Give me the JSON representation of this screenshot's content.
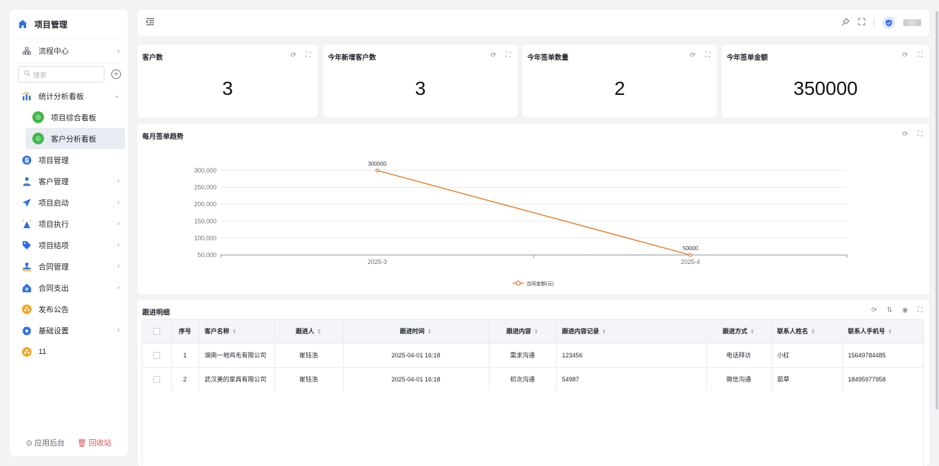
{
  "sidebar": {
    "app_title": "项目管理",
    "flow_center": "流程中心",
    "search_placeholder": "搜索",
    "items": [
      {
        "label": "统计分析看板",
        "icon": "bar-chart-icon",
        "color": "#2f6fdf",
        "expanded": true
      },
      {
        "label": "项目管理",
        "icon": "document-icon",
        "color": "#2f6fdf"
      },
      {
        "label": "客户管理",
        "icon": "user-tie-icon",
        "color": "#2f6fdf"
      },
      {
        "label": "项目启动",
        "icon": "paper-plane-icon",
        "color": "#2f6fdf"
      },
      {
        "label": "项目执行",
        "icon": "alarm-icon",
        "color": "#2f6fdf"
      },
      {
        "label": "项目结项",
        "icon": "tag-icon",
        "color": "#2f6fdf"
      },
      {
        "label": "合同管理",
        "icon": "stamp-icon",
        "color": "#2f6fdf"
      },
      {
        "label": "合同支出",
        "icon": "house-icon",
        "color": "#2f6fdf"
      },
      {
        "label": "发布公告",
        "icon": "group-icon",
        "color": "#f5a623"
      },
      {
        "label": "基础设置",
        "icon": "gear-icon",
        "color": "#2f6fdf"
      },
      {
        "label": "11",
        "icon": "group-icon",
        "color": "#f5a623"
      }
    ],
    "sub_items": [
      {
        "label": "项目综合看板"
      },
      {
        "label": "客户分析看板",
        "active": true
      }
    ],
    "footer": {
      "admin": "应用后台",
      "recycle": "回收站"
    }
  },
  "stats": [
    {
      "title": "客户数",
      "value": "3"
    },
    {
      "title": "今年新增客户数",
      "value": "3"
    },
    {
      "title": "今年签单数量",
      "value": "2"
    },
    {
      "title": "今年签单金额",
      "value": "350000"
    }
  ],
  "chart_data": {
    "type": "line",
    "title": "每月签单趋势",
    "categories": [
      "2025-3",
      "2025-4"
    ],
    "series": [
      {
        "name": "合同金额(元)",
        "values": [
          300000,
          50000
        ],
        "color": "#e8731a"
      }
    ],
    "y_ticks": [
      "300,000",
      "250,000",
      "200,000",
      "150,000",
      "100,000",
      "50,000"
    ],
    "ylim": [
      50000,
      300000
    ],
    "data_labels": [
      "300000",
      "50000"
    ],
    "legend": "bottom-center",
    "grid": true
  },
  "table": {
    "title": "跟进明细",
    "columns": [
      "序号",
      "客户名称",
      "跟进人",
      "跟进时间",
      "跟进内容",
      "跟进内容记录",
      "跟进方式",
      "联系人姓名",
      "联系人手机号"
    ],
    "rows": [
      [
        "1",
        "湖南一地鸡毛有限公司",
        "崔钰浩",
        "2025-04-01 16:18",
        "需求沟通",
        "123456",
        "电话拜访",
        "小红",
        "15649784485"
      ],
      [
        "2",
        "武汉美的家具有限公司",
        "崔钰浩",
        "2025-04-01 16:18",
        "初次沟通",
        "54987",
        "微信沟通",
        "茹草",
        "18495977958"
      ]
    ]
  }
}
